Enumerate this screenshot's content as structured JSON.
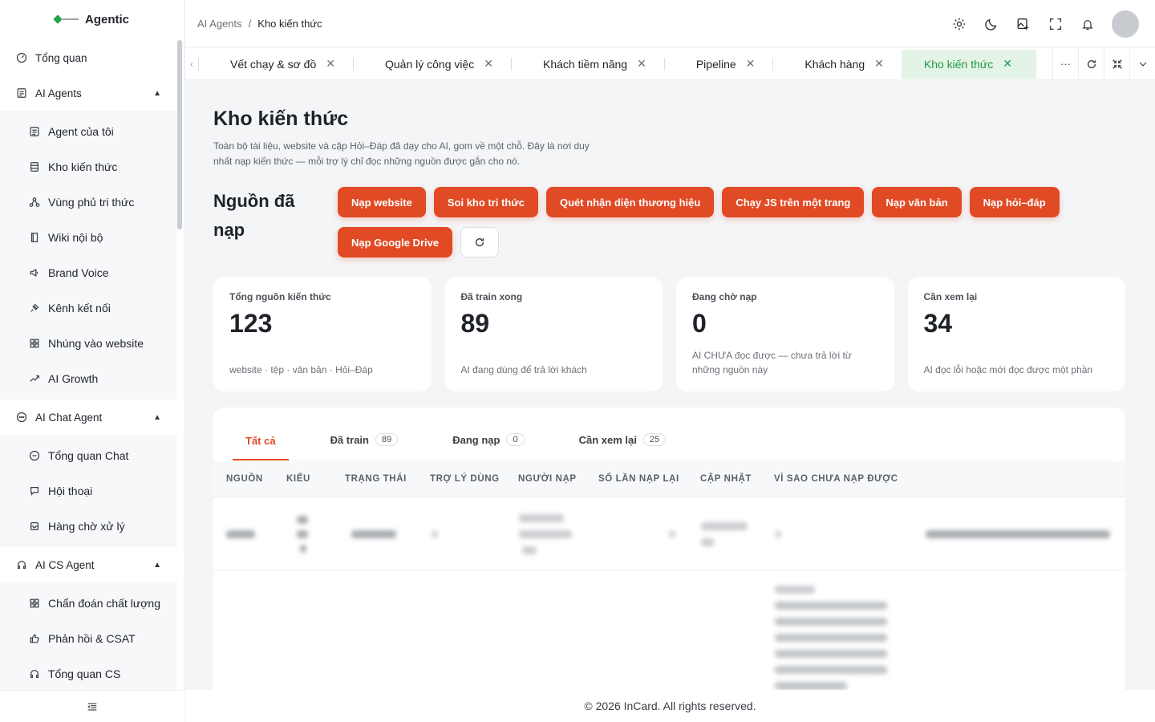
{
  "brand": {
    "name": "Agentic"
  },
  "sidebar": {
    "top_item": {
      "label": "Tổng quan",
      "icon": "dashboard-icon"
    },
    "groups": [
      {
        "label": "AI Agents",
        "icon": "agent-icon",
        "expanded": true,
        "items": [
          {
            "label": "Agent của tôi",
            "icon": "user-card-icon"
          },
          {
            "label": "Kho kiến thức",
            "icon": "database-icon"
          },
          {
            "label": "Vùng phủ tri thức",
            "icon": "network-icon"
          },
          {
            "label": "Wiki nội bộ",
            "icon": "book-icon"
          },
          {
            "label": "Brand Voice",
            "icon": "megaphone-icon"
          },
          {
            "label": "Kênh kết nối",
            "icon": "plug-icon"
          },
          {
            "label": "Nhúng vào website",
            "icon": "grid-icon"
          },
          {
            "label": "AI Growth",
            "icon": "trend-icon"
          }
        ]
      },
      {
        "label": "AI Chat Agent",
        "icon": "chat-icon",
        "expanded": true,
        "items": [
          {
            "label": "Tổng quan Chat",
            "icon": "chat-bubble-icon"
          },
          {
            "label": "Hội thoại",
            "icon": "conversation-icon"
          },
          {
            "label": "Hàng chờ xử lý",
            "icon": "inbox-icon"
          }
        ]
      },
      {
        "label": "AI CS Agent",
        "icon": "headset-icon",
        "expanded": true,
        "items": [
          {
            "label": "Chẩn đoán chất lượng",
            "icon": "grid-icon"
          },
          {
            "label": "Phản hồi & CSAT",
            "icon": "thumbs-up-icon"
          },
          {
            "label": "Tổng quan CS",
            "icon": "headset-icon"
          }
        ]
      }
    ]
  },
  "header": {
    "breadcrumb": [
      "AI Agents",
      "/",
      "Kho kiến thức"
    ]
  },
  "tabs": [
    {
      "label": "Vết chạy & sơ đồ",
      "active": false
    },
    {
      "label": "Quản lý công việc",
      "active": false
    },
    {
      "label": "Khách tiềm năng",
      "active": false
    },
    {
      "label": "Pipeline",
      "active": false
    },
    {
      "label": "Khách hàng",
      "active": false
    },
    {
      "label": "Kho kiến thức",
      "active": true
    }
  ],
  "tab_tools": {
    "more": "···"
  },
  "page": {
    "title": "Kho kiến thức",
    "description": "Toàn bộ tài liệu, website và cặp Hỏi–Đáp đã dạy cho AI, gom về một chỗ. Đây là nơi duy nhất nạp kiến thức — mỗi trợ lý chỉ đọc những nguồn được gắn cho nó.",
    "section_title": "Nguồn đã nạp",
    "actions": [
      "Nạp website",
      "Soi kho tri thức",
      "Quét nhận diện thương hiệu",
      "Chạy JS trên một trang",
      "Nạp văn bản",
      "Nạp hỏi–đáp",
      "Nạp Google Drive"
    ],
    "accent": "#e04a24"
  },
  "stats": [
    {
      "label": "Tổng nguồn kiến thức",
      "value": "123",
      "note": "website · tệp · văn bản · Hỏi–Đáp"
    },
    {
      "label": "Đã train xong",
      "value": "89",
      "note": "AI đang dùng để trả lời khách"
    },
    {
      "label": "Đang chờ nạp",
      "value": "0",
      "note": "AI CHƯA đọc được — chưa trả lời từ những nguồn này"
    },
    {
      "label": "Cần xem lại",
      "value": "34",
      "note": "AI đọc lỗi hoặc mới đọc được một phần"
    }
  ],
  "filter_tabs": [
    {
      "label": "Tất cả",
      "count": null,
      "active": true
    },
    {
      "label": "Đã train",
      "count": "89",
      "active": false
    },
    {
      "label": "Đang nạp",
      "count": "0",
      "active": false
    },
    {
      "label": "Cần xem lại",
      "count": "25",
      "active": false
    }
  ],
  "table": {
    "columns": [
      "NGUỒN",
      "KIỂU",
      "TRẠNG THÁI",
      "TRỢ LÝ DÙNG",
      "NGƯỜI NẠP",
      "SỐ LẦN NẠP LẠI",
      "CẬP NHẬT",
      "VÌ SAO CHƯA NẠP ĐƯỢC"
    ]
  },
  "footer": {
    "text": "© 2026 InCard. All rights reserved."
  }
}
